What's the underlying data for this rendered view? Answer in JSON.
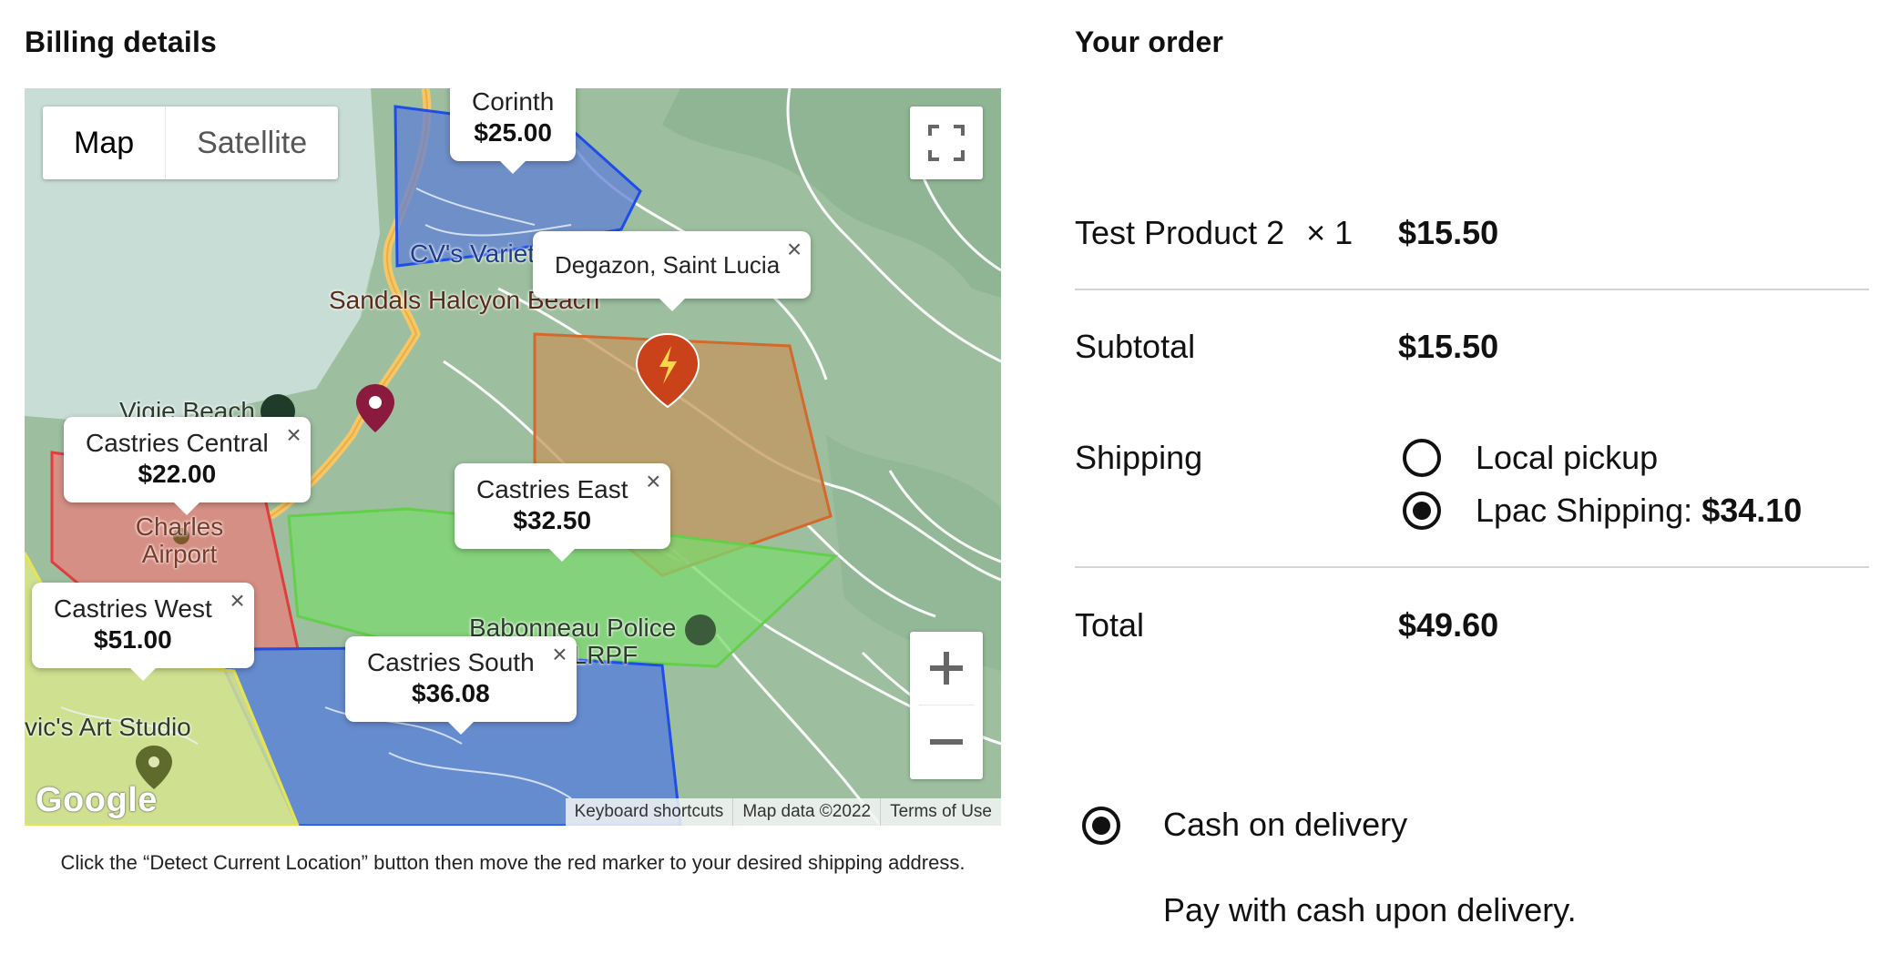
{
  "billing": {
    "title": "Billing details",
    "map": {
      "type_buttons": [
        "Map",
        "Satellite"
      ],
      "active_type": "Map",
      "zones": [
        {
          "name": "Corinth",
          "price": "$25.00",
          "color": "#3a66e0"
        },
        {
          "name": "Castries Central",
          "price": "$22.00",
          "color": "#e05a5a"
        },
        {
          "name": "Castries East",
          "price": "$32.50",
          "color": "#6fe06f"
        },
        {
          "name": "Castries West",
          "price": "$51.00",
          "color": "#e8e86a"
        },
        {
          "name": "Castries South",
          "price": "$36.08",
          "color": "#3a66e0"
        }
      ],
      "marker_popup": "Degazon, Saint Lucia",
      "place_labels": [
        "CV's Variet",
        "Sandals Halcyon Beach",
        "Vigie Beach",
        "Charles Airport",
        "Babonneau Police Station SLRPF",
        "vic's Art Studio"
      ],
      "attribution": [
        "Keyboard shortcuts",
        "Map data ©2022",
        "Terms of Use"
      ],
      "logo": "Google"
    },
    "hint": "Click the “Detect Current Location” button then move the red marker to your desired shipping address."
  },
  "order": {
    "title": "Your order",
    "product_name": "Test Product 2",
    "product_qty": "× 1",
    "product_price": "$15.50",
    "subtotal_label": "Subtotal",
    "subtotal_value": "$15.50",
    "shipping_label": "Shipping",
    "shipping_options": [
      {
        "label": "Local pickup",
        "price": "",
        "checked": false
      },
      {
        "label": "Lpac Shipping: ",
        "price": "$34.10",
        "checked": true
      }
    ],
    "total_label": "Total",
    "total_value": "$49.60"
  },
  "payment": {
    "method_label": "Cash on delivery",
    "method_checked": true,
    "description": "Pay with cash upon delivery."
  }
}
